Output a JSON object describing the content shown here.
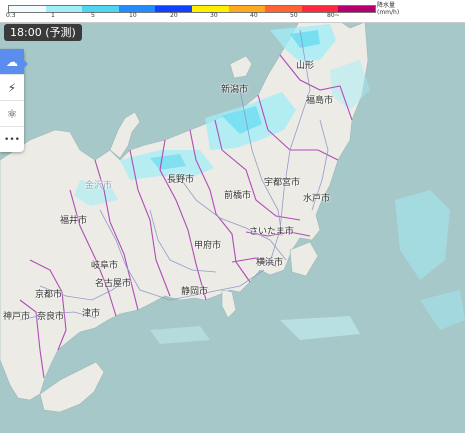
{
  "legend": {
    "ticks": [
      "0.3",
      "1",
      "5",
      "10",
      "20",
      "30",
      "40",
      "50",
      "80~"
    ],
    "unit_line1": "降水量",
    "unit_line2": "(mm/h)",
    "colors": [
      "#f2fbfd",
      "#a0eef8",
      "#4cd6f0",
      "#218cff",
      "#0f41ff",
      "#fff000",
      "#ffaa1e",
      "#ff6432",
      "#ff283c",
      "#b4006e"
    ]
  },
  "time_badge": "18:00 (予測)",
  "toolbar": {
    "tools": [
      {
        "name": "rain-cloud-icon",
        "glyph": "☁"
      },
      {
        "name": "lightning-icon",
        "glyph": "⚡"
      },
      {
        "name": "atom-icon",
        "glyph": "⚛"
      },
      {
        "name": "more-icon",
        "glyph": "•••"
      }
    ]
  },
  "cities": {
    "yamagata": "山形",
    "niigata": "新潟市",
    "fukushima": "福島市",
    "nagano": "長野市",
    "utsunomiya": "宇都宮市",
    "maebashi": "前橋市",
    "mito": "水戸市",
    "kanazawa": "金沢市",
    "fukui": "福井市",
    "saitama": "さいたま市",
    "kofu": "甲府市",
    "yokohama": "横浜市",
    "gifu": "岐阜市",
    "nagoya": "名古屋市",
    "shizuoka": "静岡市",
    "kyoto": "京都市",
    "kobe": "神戸市",
    "nara": "奈良市",
    "tsu": "津市"
  }
}
